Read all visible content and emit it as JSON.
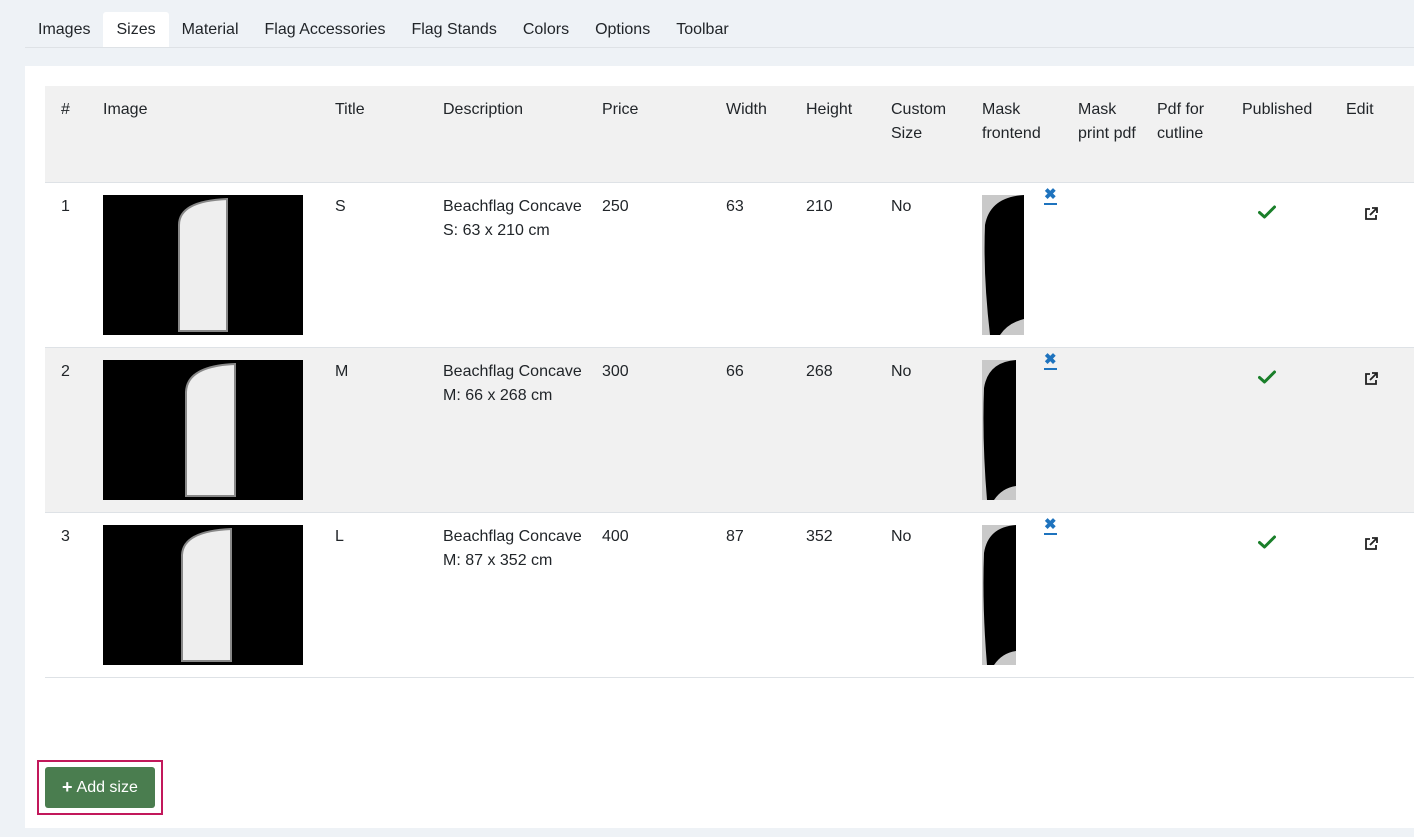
{
  "tabs": [
    "Images",
    "Sizes",
    "Material",
    "Flag Accessories",
    "Flag Stands",
    "Colors",
    "Options",
    "Toolbar"
  ],
  "active_tab": "Sizes",
  "table": {
    "headers": {
      "num": "#",
      "image": "Image",
      "title": "Title",
      "description": "Description",
      "price": "Price",
      "width": "Width",
      "height": "Height",
      "custom_size": "Custom Size",
      "mask_frontend": "Mask frontend",
      "mask_print_pdf": "Mask print pdf",
      "pdf_for_cutline": "Pdf for cutline",
      "published": "Published",
      "edit": "Edit"
    },
    "rows": [
      {
        "num": "1",
        "title": "S",
        "description": "Beachflag Concave S: 63 x 210 cm",
        "price": "250",
        "width": "63",
        "height": "210",
        "custom_size": "No",
        "delete_glyph": "✖"
      },
      {
        "num": "2",
        "title": "M",
        "description": "Beachflag Concave M: 66 x 268 cm",
        "price": "300",
        "width": "66",
        "height": "268",
        "custom_size": "No",
        "delete_glyph": "✖"
      },
      {
        "num": "3",
        "title": "L",
        "description": "Beachflag Concave M: 87 x 352 cm",
        "price": "400",
        "width": "87",
        "height": "352",
        "custom_size": "No",
        "delete_glyph": "✖"
      }
    ]
  },
  "add_button": {
    "icon": "plus-icon",
    "label": "Add size"
  },
  "colors": {
    "button": "#4a7d4f",
    "highlight": "#c2185b",
    "check": "#1a7f2a",
    "delete": "#1e73be"
  }
}
